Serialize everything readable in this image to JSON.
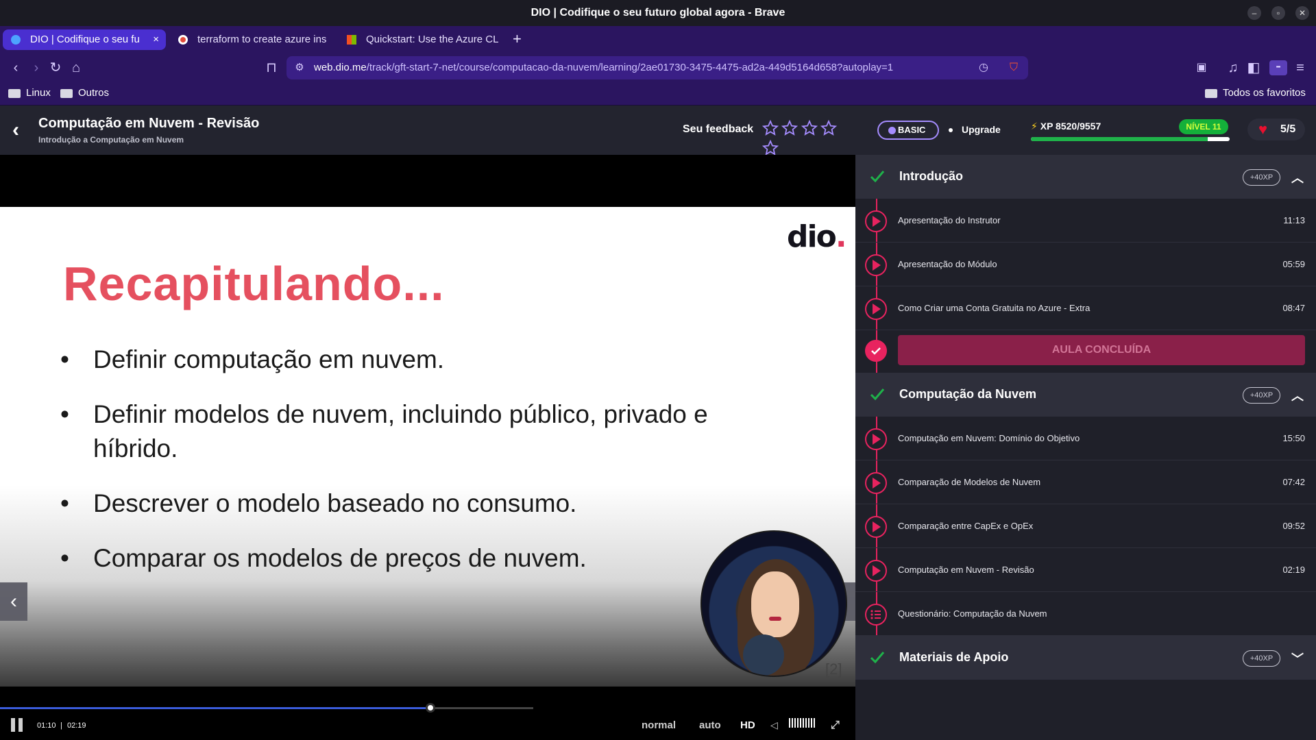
{
  "window": {
    "title": "DIO | Codifique o seu futuro global agora - Brave"
  },
  "tabs": [
    {
      "label": "DIO | Codifique o seu fu",
      "active": true
    },
    {
      "label": "terraform to create azure ins",
      "active": false
    },
    {
      "label": "Quickstart: Use the Azure CLI",
      "active": false
    }
  ],
  "address": {
    "host": "web.dio.me",
    "path": "/track/gft-start-7-net/course/computacao-da-nuvem/learning/2ae01730-3475-4475-ad2a-449d5164d658?autoplay=1"
  },
  "bookmarks": {
    "items": [
      "Linux",
      "Outros"
    ],
    "all": "Todos os favoritos"
  },
  "header": {
    "title": "Computação em Nuvem - Revisão",
    "subtitle": "Introdução a Computação em Nuvem",
    "feedback_label": "Seu feedback",
    "stars": 5
  },
  "account": {
    "plan": "BASIC",
    "upgrade": "Upgrade",
    "xp_text": "XP 8520/9557",
    "xp_progress": 0.891,
    "level": "NÍVEL 11",
    "lives": "5/5"
  },
  "slide": {
    "logo": "dio",
    "title": "Recapitulando...",
    "bullets": [
      "Definir computação em nuvem.",
      "Definir modelos de nuvem, incluindo público, privado e híbrido.",
      "Descrever o modelo baseado no consumo.",
      "Comparar os modelos de preços de nuvem."
    ],
    "page_marker": "[2]"
  },
  "player": {
    "current": "01:10",
    "separator": "|",
    "duration": "02:19",
    "progress": 0.503,
    "speed": "normal",
    "quality_mode": "auto",
    "quality": "HD"
  },
  "sections": [
    {
      "title": "Introdução",
      "xp": "+40XP",
      "expanded": true,
      "lessons": [
        {
          "label": "Apresentação do Instrutor",
          "duration": "11:13"
        },
        {
          "label": "Apresentação do Módulo",
          "duration": "05:59"
        },
        {
          "label": "Como Criar uma Conta Gratuita no Azure - Extra",
          "duration": "08:47"
        }
      ],
      "done_label": "AULA CONCLUÍDA"
    },
    {
      "title": "Computação da Nuvem",
      "xp": "+40XP",
      "expanded": true,
      "lessons": [
        {
          "label": "Computação em Nuvem: Domínio do Objetivo",
          "duration": "15:50"
        },
        {
          "label": "Comparação de Modelos de Nuvem",
          "duration": "07:42"
        },
        {
          "label": "Comparação entre CapEx e OpEx",
          "duration": "09:52"
        },
        {
          "label": "Computação em Nuvem - Revisão",
          "duration": "02:19"
        },
        {
          "label": "Questionário: Computação da Nuvem",
          "duration": ""
        }
      ]
    },
    {
      "title": "Materiais de Apoio",
      "xp": "+40XP",
      "expanded": false
    }
  ],
  "colors": {
    "accent": "#e8235f",
    "brand_purple": "#2b1560",
    "success": "#1fb24a",
    "slide_title": "#e5505f"
  }
}
